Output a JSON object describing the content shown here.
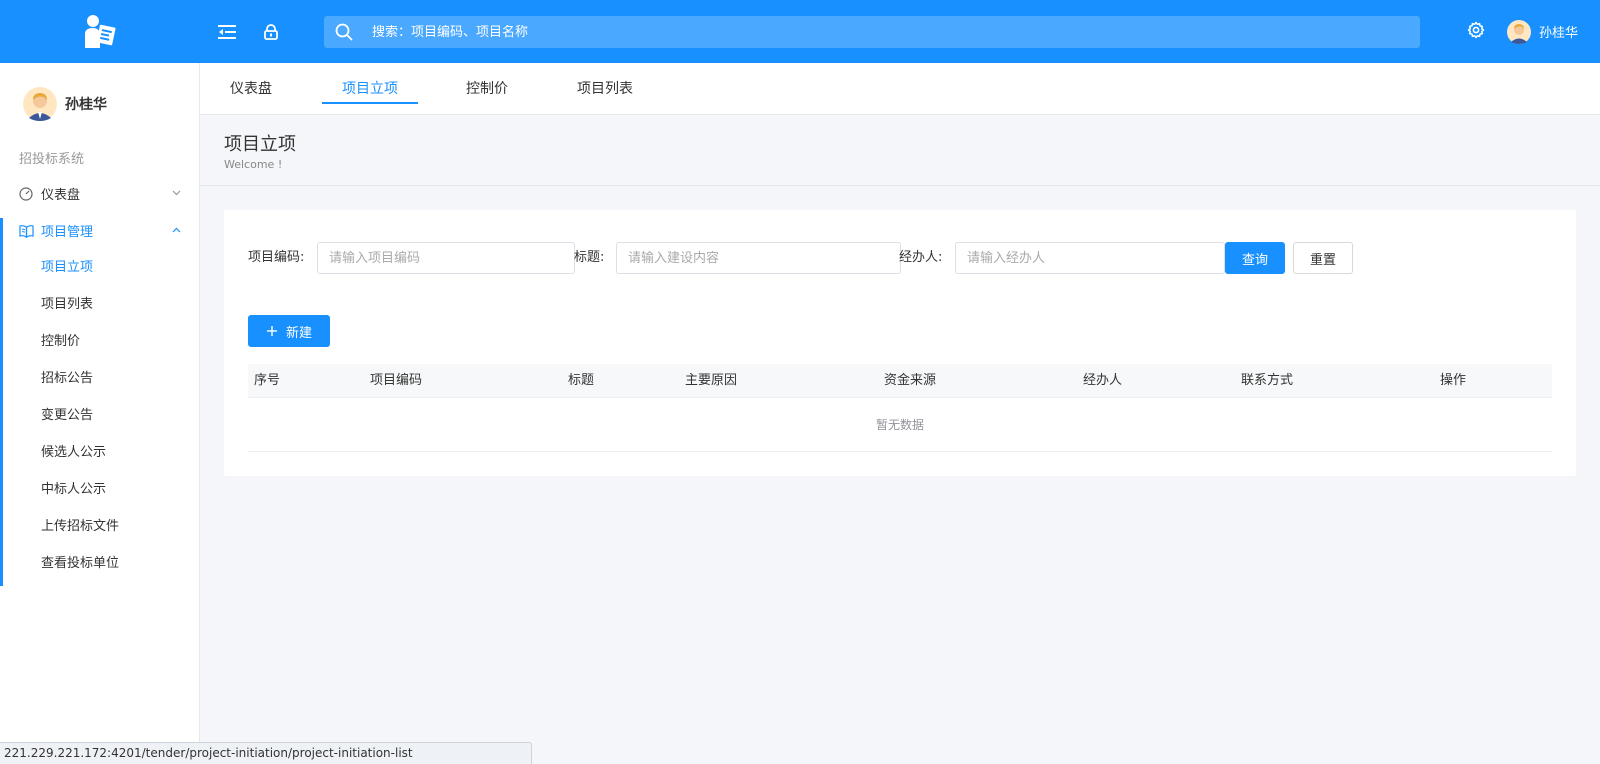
{
  "header": {
    "search_placeholder": "搜索：项目编码、项目名称",
    "user_name": "孙桂华",
    "bg_color": "#1890ff"
  },
  "sidebar": {
    "user_name": "孙桂华",
    "group_title": "招投标系统",
    "menu": [
      {
        "label": "仪表盘",
        "icon": "dashboard-icon",
        "expanded": false
      },
      {
        "label": "项目管理",
        "icon": "book-icon",
        "expanded": true
      }
    ],
    "sub_items": [
      {
        "label": "项目立项",
        "active": true
      },
      {
        "label": "项目列表"
      },
      {
        "label": "控制价"
      },
      {
        "label": "招标公告"
      },
      {
        "label": "变更公告"
      },
      {
        "label": "候选人公示"
      },
      {
        "label": "中标人公示"
      },
      {
        "label": "上传招标文件"
      },
      {
        "label": "查看投标单位"
      }
    ]
  },
  "tabs": [
    {
      "label": "仪表盘"
    },
    {
      "label": "项目立项",
      "active": true
    },
    {
      "label": "控制价"
    },
    {
      "label": "项目列表"
    }
  ],
  "page": {
    "title": "项目立项",
    "subtitle": "Welcome !"
  },
  "filters": {
    "code_label": "项目编码:",
    "code_placeholder": "请输入项目编码",
    "title_label": "标题:",
    "title_placeholder": "请输入建设内容",
    "handler_label": "经办人:",
    "handler_placeholder": "请输入经办人",
    "query_button": "查询",
    "reset_button": "重置"
  },
  "actions": {
    "new_button": "新建"
  },
  "table": {
    "columns": [
      "序号",
      "项目编码",
      "标题",
      "主要原因",
      "资金来源",
      "经办人",
      "联系方式",
      "操作"
    ],
    "empty_text": "暂无数据"
  },
  "status_bar": {
    "url": "221.229.221.172:4201/tender/project-initiation/project-initiation-list"
  },
  "colors": {
    "primary": "#1890ff",
    "page_bg": "#f4f6f9"
  }
}
